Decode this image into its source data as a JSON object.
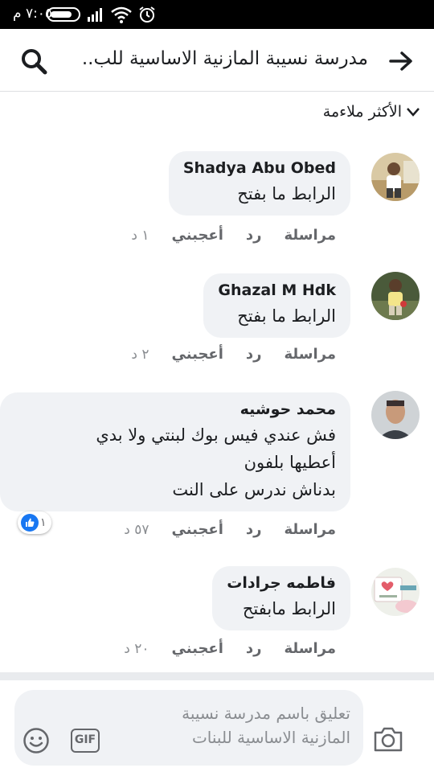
{
  "status_bar": {
    "time": "٧:٠٥ م",
    "battery_level": 0.8,
    "icons": [
      "battery-icon",
      "signal-icon",
      "wifi-icon",
      "alarm-icon"
    ]
  },
  "header": {
    "title": "مدرسة نسيبة المازنية الاساسية للب..",
    "search_icon": "search-icon",
    "back_icon": "back-arrow-icon"
  },
  "sort": {
    "label": "الأكثر ملاءمة",
    "icon": "chevron-down-icon"
  },
  "comments": [
    {
      "author": "Shadya Abu Obed",
      "text_lines": [
        "الرابط ما بفتح"
      ],
      "time": "١ د",
      "like_label": "أعجبني",
      "reply_label": "رد",
      "message_label": "مراسلة"
    },
    {
      "author": "Ghazal M Hdk",
      "text_lines": [
        "الرابط ما بفتح"
      ],
      "time": "٢ د",
      "like_label": "أعجبني",
      "reply_label": "رد",
      "message_label": "مراسلة"
    },
    {
      "author": "محمد حوشيه",
      "text_lines": [
        "فش عندي فيس بوك لبنتي ولا بدي",
        "أعطيها بلفون",
        "بدناش ندرس على النت"
      ],
      "time": "٥٧ د",
      "like_label": "أعجبني",
      "reply_label": "رد",
      "message_label": "مراسلة",
      "reaction_count": "١"
    },
    {
      "author": "فاطمه جرادات",
      "text_lines": [
        "الرابط مابفتح"
      ],
      "time": "٢٠ د",
      "like_label": "أعجبني",
      "reply_label": "رد",
      "message_label": "مراسلة"
    }
  ],
  "composer": {
    "placeholder_lines": [
      "تعليق باسم مدرسة نسيبة",
      "المازنية الاساسية للبنات"
    ],
    "gif_label": "GIF",
    "emoji_icon": "emoji-icon",
    "camera_icon": "camera-icon"
  },
  "colors": {
    "like_blue": "#1877f2",
    "bubble_bg": "#f0f2f5",
    "muted_text": "#65676b"
  }
}
